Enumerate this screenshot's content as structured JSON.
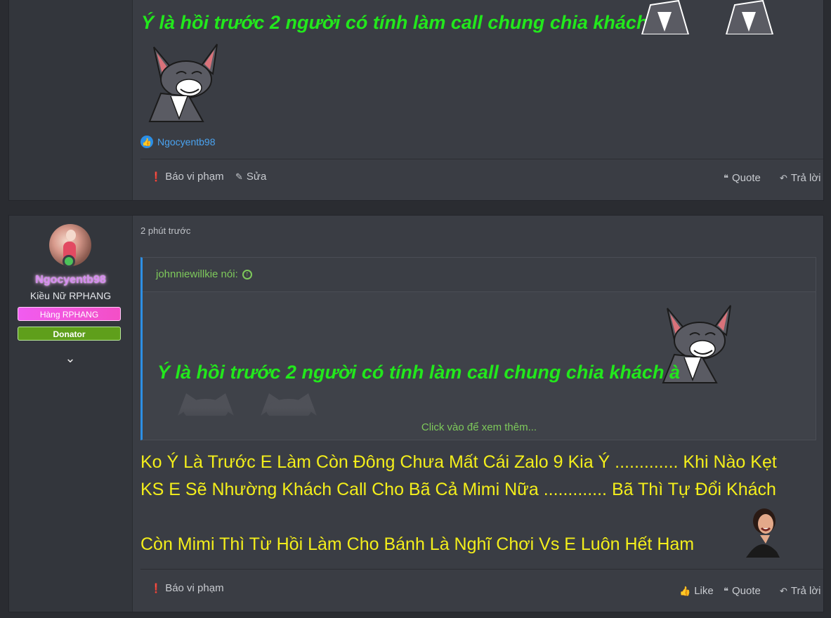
{
  "post_top": {
    "green_text": "Ý là hồi trước 2 người có tính làm call chung chia khách à",
    "reaction_user": "Ngocyentb98",
    "actions": {
      "report": "Báo vi phạm",
      "edit": "Sửa",
      "quote": "Quote",
      "reply": "Trả lời"
    }
  },
  "post_bottom": {
    "user": {
      "name": "Ngocyentb98",
      "title": "Kiều Nữ RPHANG",
      "banner_rank": "Hàng RPHANG",
      "banner_donator": "Donator"
    },
    "timestamp": "2 phút trước",
    "quote": {
      "author": "johnniewillkie nói:",
      "text": "Ý là hồi trước 2 người có tính làm call chung chia khách à",
      "expand": "Click vào để xem thêm..."
    },
    "message_lines": [
      "Ko Ý Là Trước E Làm Còn Đông Chưa Mất Cái Zalo 9 Kia Ý ............. Khi Nào Kẹt",
      "KS E Sẽ Nhường Khách Call Cho Bã Cả Mimi Nữa ............. Bã Thì Tự Đổi Khách",
      "Còn Mimi Thì Từ Hồi Làm Cho Bánh Là Nghĩ Chơi Vs E Luôn Hết Ham"
    ],
    "actions": {
      "report": "Báo vi phạm",
      "like": "Like",
      "quote": "Quote",
      "reply": "Trả lời"
    }
  },
  "colors": {
    "green_text": "#22e81c",
    "yellow_text": "#f3ee1b",
    "quote_accent": "#2d8fe4",
    "quote_author": "#7ec95b"
  }
}
